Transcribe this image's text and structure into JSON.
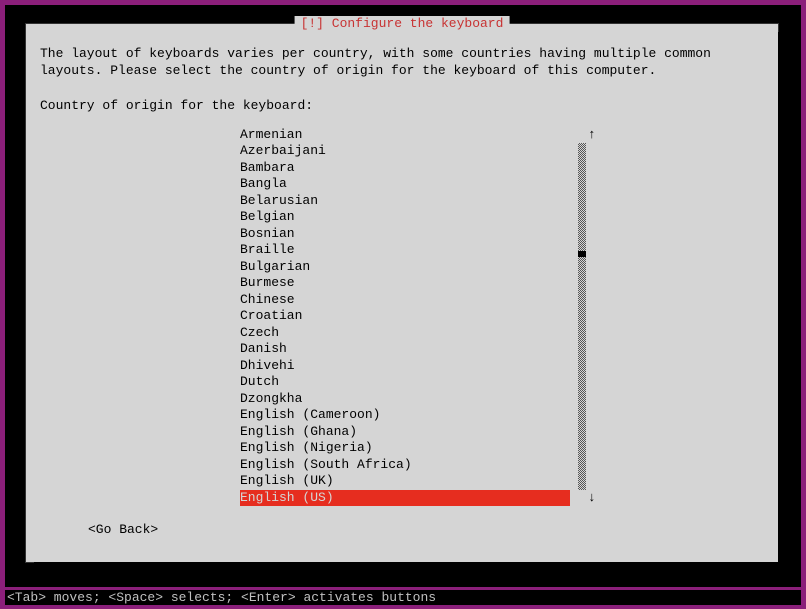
{
  "dialog": {
    "title": "[!] Configure the keyboard",
    "body": "The layout of keyboards varies per country, with some countries having multiple common layouts. Please select the country of origin for the keyboard of this computer.",
    "prompt": "Country of origin for the keyboard:",
    "go_back": "<Go Back>",
    "scroll_up": "↑",
    "scroll_down": "↓",
    "items": [
      {
        "label": "Armenian",
        "selected": false
      },
      {
        "label": "Azerbaijani",
        "selected": false
      },
      {
        "label": "Bambara",
        "selected": false
      },
      {
        "label": "Bangla",
        "selected": false
      },
      {
        "label": "Belarusian",
        "selected": false
      },
      {
        "label": "Belgian",
        "selected": false
      },
      {
        "label": "Bosnian",
        "selected": false
      },
      {
        "label": "Braille",
        "selected": false
      },
      {
        "label": "Bulgarian",
        "selected": false
      },
      {
        "label": "Burmese",
        "selected": false
      },
      {
        "label": "Chinese",
        "selected": false
      },
      {
        "label": "Croatian",
        "selected": false
      },
      {
        "label": "Czech",
        "selected": false
      },
      {
        "label": "Danish",
        "selected": false
      },
      {
        "label": "Dhivehi",
        "selected": false
      },
      {
        "label": "Dutch",
        "selected": false
      },
      {
        "label": "Dzongkha",
        "selected": false
      },
      {
        "label": "English (Cameroon)",
        "selected": false
      },
      {
        "label": "English (Ghana)",
        "selected": false
      },
      {
        "label": "English (Nigeria)",
        "selected": false
      },
      {
        "label": "English (South Africa)",
        "selected": false
      },
      {
        "label": "English (UK)",
        "selected": false
      },
      {
        "label": "English (US)",
        "selected": true
      }
    ],
    "scroll_thumb_offset_percent": 31
  },
  "help": "<Tab> moves; <Space> selects; <Enter> activates buttons"
}
